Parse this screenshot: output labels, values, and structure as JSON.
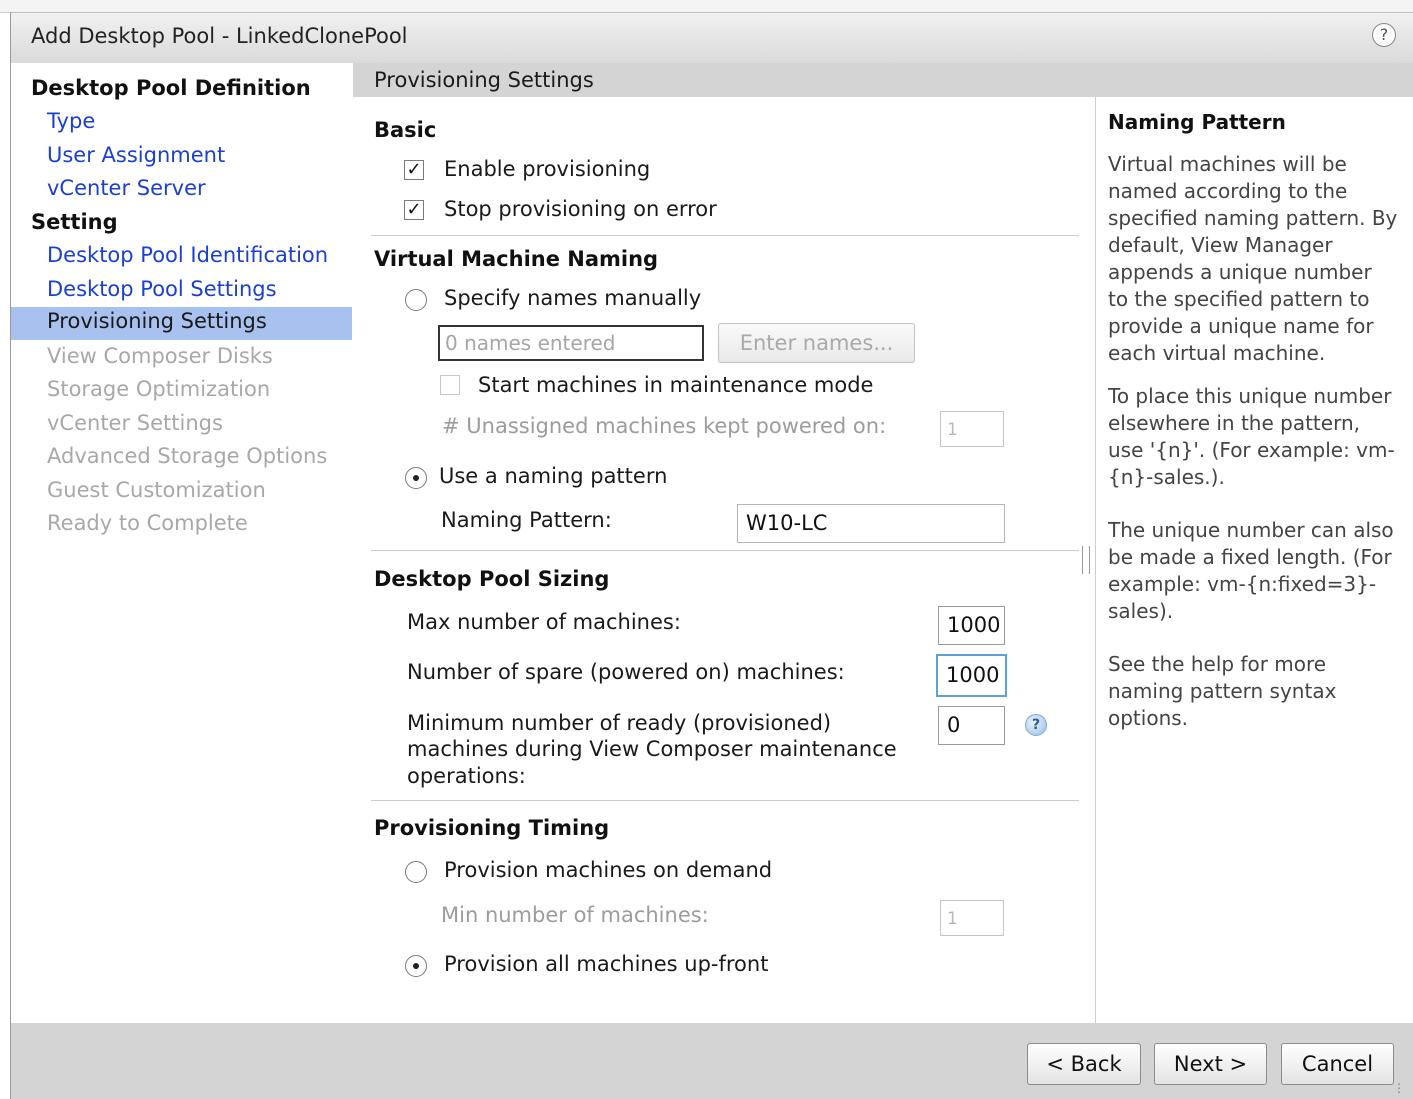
{
  "window": {
    "title": "Add Desktop Pool - LinkedClonePool",
    "help_glyph": "?"
  },
  "sidebar": {
    "section1_title": "Desktop Pool Definition",
    "section1_items": [
      {
        "label": "Type",
        "state": "link"
      },
      {
        "label": "User Assignment",
        "state": "link"
      },
      {
        "label": "vCenter Server",
        "state": "link"
      }
    ],
    "section2_title": "Setting",
    "section2_items": [
      {
        "label": "Desktop Pool Identification",
        "state": "link"
      },
      {
        "label": "Desktop Pool Settings",
        "state": "link"
      },
      {
        "label": "Provisioning Settings",
        "state": "selected"
      },
      {
        "label": "View Composer Disks",
        "state": "disabled"
      },
      {
        "label": "Storage Optimization",
        "state": "disabled"
      },
      {
        "label": "vCenter Settings",
        "state": "disabled"
      },
      {
        "label": "Advanced Storage Options",
        "state": "disabled"
      },
      {
        "label": "Guest Customization",
        "state": "disabled"
      },
      {
        "label": "Ready to Complete",
        "state": "disabled"
      }
    ]
  },
  "main": {
    "header": "Provisioning Settings",
    "basic": {
      "title": "Basic",
      "enable_provisioning": {
        "label": "Enable provisioning",
        "checked": true
      },
      "stop_on_error": {
        "label": "Stop provisioning on error",
        "checked": true
      }
    },
    "naming": {
      "title": "Virtual Machine Naming",
      "manual": {
        "label": "Specify names manually",
        "selected": false,
        "names_field": "0 names entered",
        "enter_names_button": "Enter names...",
        "maintenance_label": "Start machines in maintenance mode",
        "maintenance_checked": false,
        "unassigned_label": "# Unassigned machines kept powered on:",
        "unassigned_value": "1"
      },
      "pattern": {
        "label": "Use a naming pattern",
        "selected": true,
        "field_label": "Naming Pattern:",
        "field_value": "W10-LC"
      }
    },
    "sizing": {
      "title": "Desktop Pool Sizing",
      "max_label": "Max number of machines:",
      "max_value": "1000",
      "spare_label": "Number of spare (powered on) machines:",
      "spare_value": "1000",
      "min_ready_label_line1": "Minimum number of ready (provisioned)",
      "min_ready_label_line2": "machines during View Composer maintenance",
      "min_ready_label_line3": "operations:",
      "min_ready_value": "0",
      "help_glyph": "?"
    },
    "timing": {
      "title": "Provisioning Timing",
      "on_demand": {
        "label": "Provision machines on demand",
        "selected": false
      },
      "min_label": "Min number of machines:",
      "min_value": "1",
      "up_front": {
        "label": "Provision all machines up-front",
        "selected": true
      }
    }
  },
  "help_panel": {
    "title": "Naming Pattern",
    "p1": "Virtual machines will be named according to the specified naming pattern. By default, View Manager appends a unique number to the specified pattern to provide a unique name for each virtual machine.",
    "p2": "To place this unique number elsewhere in the pattern, use '{n}'. (For example: vm-{n}-sales.).",
    "p3": "The unique number can also be made a fixed length. (For example: vm-{n:fixed=3}-sales).",
    "p4": "See the help for more naming pattern syntax options."
  },
  "footer": {
    "back_label": "< Back",
    "next_label": "Next >",
    "cancel_label": "Cancel"
  }
}
